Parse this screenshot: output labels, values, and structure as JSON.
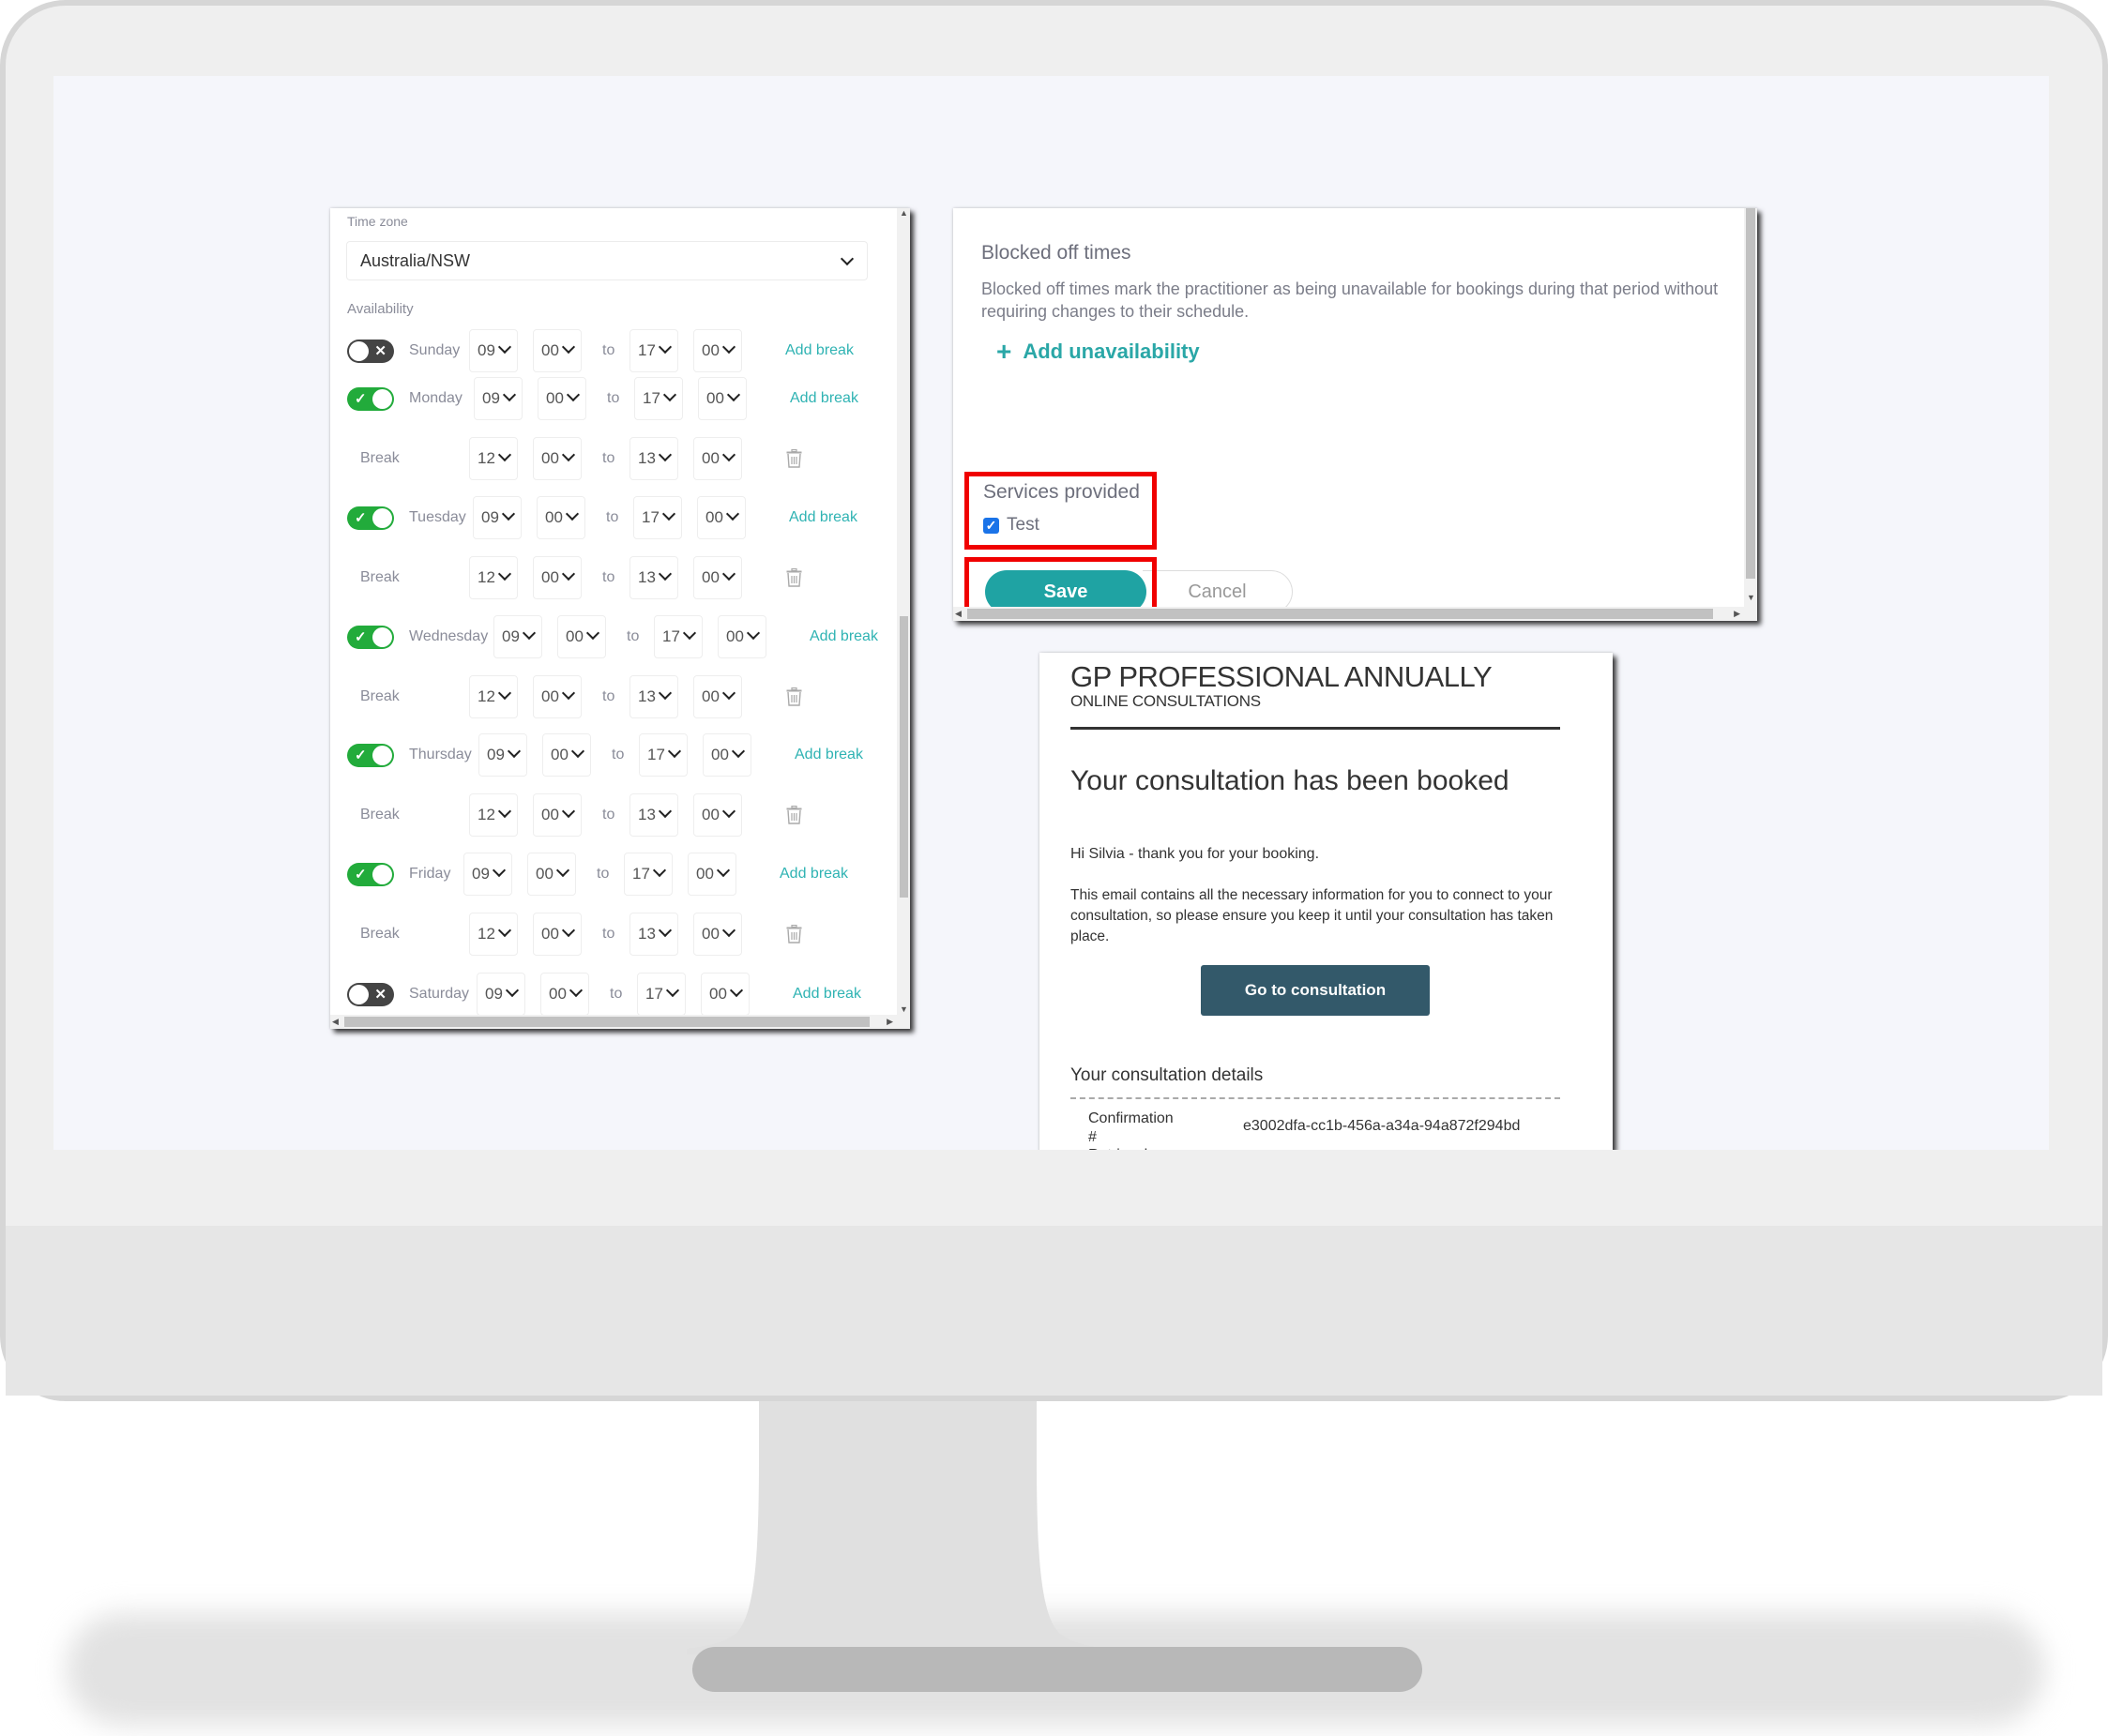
{
  "schedule": {
    "timezone_label": "Time zone",
    "timezone_value": "Australia/NSW",
    "availability_label": "Availability",
    "to_label": "to",
    "add_break_label": "Add break",
    "break_label": "Break",
    "days": [
      {
        "name": "Sunday",
        "enabled": false,
        "start_h": "09",
        "start_m": "00",
        "end_h": "17",
        "end_m": "00",
        "break": null
      },
      {
        "name": "Monday",
        "enabled": true,
        "start_h": "09",
        "start_m": "00",
        "end_h": "17",
        "end_m": "00",
        "break": {
          "start_h": "12",
          "start_m": "00",
          "end_h": "13",
          "end_m": "00"
        }
      },
      {
        "name": "Tuesday",
        "enabled": true,
        "start_h": "09",
        "start_m": "00",
        "end_h": "17",
        "end_m": "00",
        "break": {
          "start_h": "12",
          "start_m": "00",
          "end_h": "13",
          "end_m": "00"
        }
      },
      {
        "name": "Wednesday",
        "enabled": true,
        "start_h": "09",
        "start_m": "00",
        "end_h": "17",
        "end_m": "00",
        "break": {
          "start_h": "12",
          "start_m": "00",
          "end_h": "13",
          "end_m": "00"
        }
      },
      {
        "name": "Thursday",
        "enabled": true,
        "start_h": "09",
        "start_m": "00",
        "end_h": "17",
        "end_m": "00",
        "break": {
          "start_h": "12",
          "start_m": "00",
          "end_h": "13",
          "end_m": "00"
        }
      },
      {
        "name": "Friday",
        "enabled": true,
        "start_h": "09",
        "start_m": "00",
        "end_h": "17",
        "end_m": "00",
        "break": {
          "start_h": "12",
          "start_m": "00",
          "end_h": "13",
          "end_m": "00"
        }
      },
      {
        "name": "Saturday",
        "enabled": false,
        "start_h": "09",
        "start_m": "00",
        "end_h": "17",
        "end_m": "00",
        "break": null
      }
    ]
  },
  "blocked": {
    "title": "Blocked off times",
    "description": "Blocked off times mark the practitioner as being unavailable for bookings during that period without requiring changes to their schedule.",
    "add_label": "Add unavailability",
    "services_title": "Services provided",
    "service_item": "Test",
    "service_checked": true,
    "save_label": "Save",
    "cancel_label": "Cancel"
  },
  "email": {
    "brand": "GP PROFESSIONAL ANNUALLY",
    "subtitle": "ONLINE CONSULTATIONS",
    "title": "Your consultation has been booked",
    "greeting": "Hi Silvia - thank you for your booking.",
    "body": "This email contains all the necessary information for you to connect to your consultation, so please ensure you keep it until your consultation has taken place.",
    "button_label": "Go to consultation",
    "details_title": "Your consultation details",
    "details": [
      {
        "key": "Confirmation #",
        "value": "e3002dfa-cc1b-456a-a34a-94a872f294bd"
      },
      {
        "key": "Retrieval",
        "value": ""
      }
    ]
  },
  "colors": {
    "accent_teal": "#1fa3a3",
    "link_teal": "#2fb3b3",
    "toggle_on": "#22ab3b",
    "toggle_off": "#444444",
    "highlight_red": "#f00000",
    "email_button": "#33596a"
  }
}
